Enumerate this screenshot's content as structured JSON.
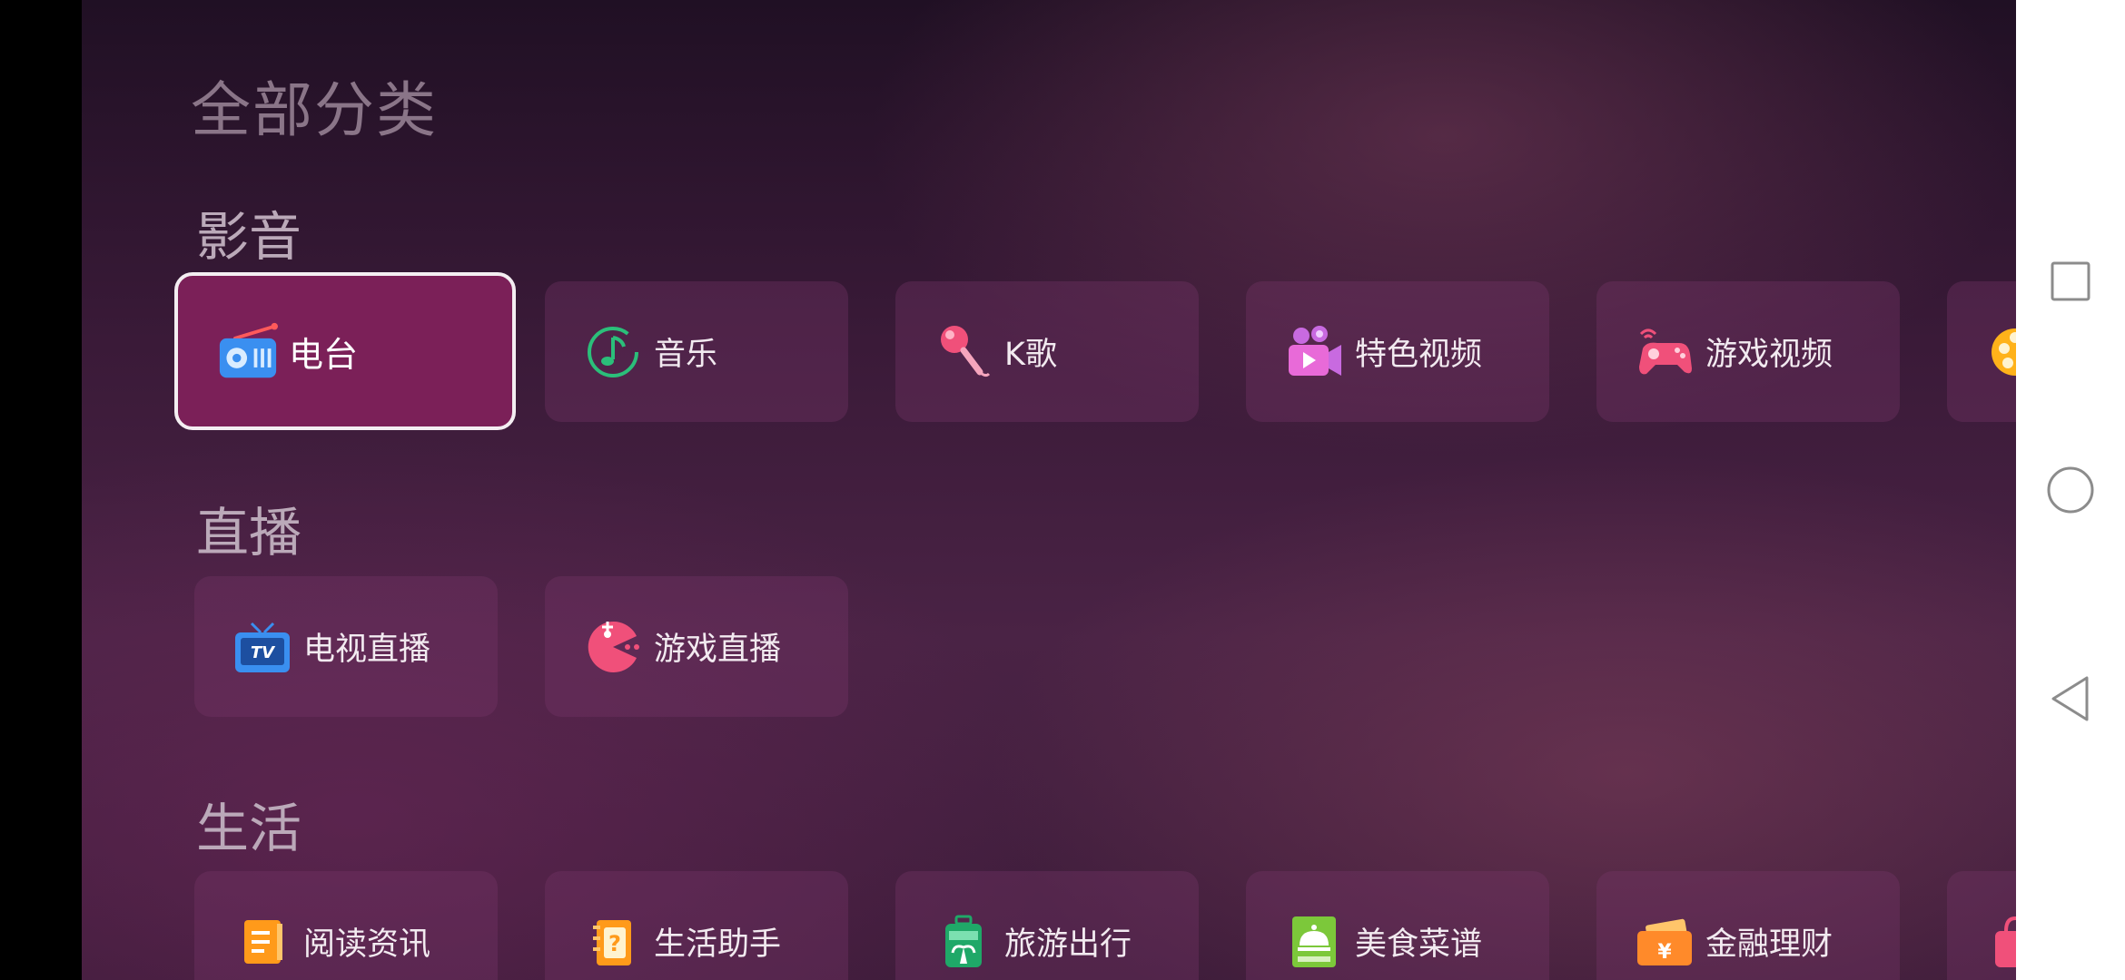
{
  "page": {
    "title": "全部分类"
  },
  "sections": [
    {
      "title": "影音",
      "items": [
        {
          "label": "电台",
          "icon": "radio-icon",
          "focused": true
        },
        {
          "label": "音乐",
          "icon": "music-note-icon"
        },
        {
          "label": "K歌",
          "icon": "microphone-icon"
        },
        {
          "label": "特色视频",
          "icon": "video-camera-icon"
        },
        {
          "label": "游戏视频",
          "icon": "gamepad-icon"
        },
        {
          "label": "",
          "icon": "film-reel-icon"
        }
      ]
    },
    {
      "title": "直播",
      "items": [
        {
          "label": "电视直播",
          "icon": "tv-icon"
        },
        {
          "label": "游戏直播",
          "icon": "pacman-icon"
        }
      ]
    },
    {
      "title": "生活",
      "items": [
        {
          "label": "阅读资讯",
          "icon": "book-icon"
        },
        {
          "label": "生活助手",
          "icon": "notebook-question-icon"
        },
        {
          "label": "旅游出行",
          "icon": "luggage-icon"
        },
        {
          "label": "美食菜谱",
          "icon": "food-cloche-icon"
        },
        {
          "label": "金融理财",
          "icon": "wallet-yen-icon"
        },
        {
          "label": "",
          "icon": "shopping-bag-icon"
        }
      ]
    }
  ],
  "navbar": {
    "recent": "recent-apps-square-icon",
    "home": "home-circle-icon",
    "back": "back-triangle-icon"
  },
  "colors": {
    "focused_tile": "#7b2058",
    "tile": "rgba(120,55,105,0.35)",
    "accent_pink": "#f0507a",
    "accent_green": "#2bbf7a",
    "accent_blue": "#3a8ff0",
    "accent_orange": "#ff9a1a"
  }
}
